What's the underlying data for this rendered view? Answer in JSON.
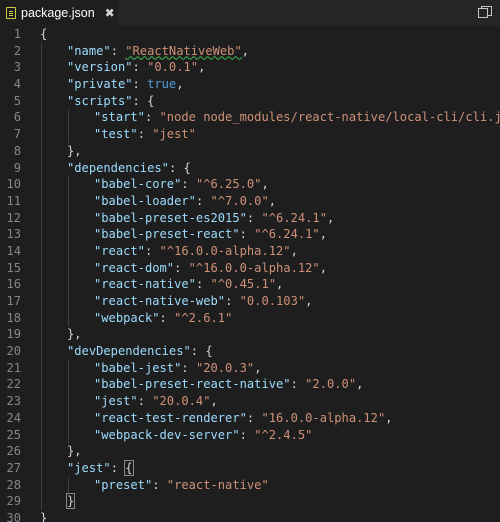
{
  "tab": {
    "title": "package.json",
    "close_glyph": "✖",
    "icon": "json-file-icon"
  },
  "toolbar": {
    "split_icon": "split-editor-icon"
  },
  "editor": {
    "lines": [
      {
        "num": "1",
        "indent": 0,
        "tokens": [
          {
            "t": "p",
            "v": "{"
          }
        ]
      },
      {
        "num": "2",
        "indent": 1,
        "tokens": [
          {
            "t": "k",
            "v": "\"name\""
          },
          {
            "t": "p",
            "v": ": "
          },
          {
            "t": "s",
            "v": "\"ReactNativeWeb\"",
            "sq": true
          },
          {
            "t": "p",
            "v": ","
          }
        ]
      },
      {
        "num": "3",
        "indent": 1,
        "tokens": [
          {
            "t": "k",
            "v": "\"version\""
          },
          {
            "t": "p",
            "v": ": "
          },
          {
            "t": "s",
            "v": "\"0.0.1\""
          },
          {
            "t": "p",
            "v": ","
          }
        ]
      },
      {
        "num": "4",
        "indent": 1,
        "tokens": [
          {
            "t": "k",
            "v": "\"private\""
          },
          {
            "t": "p",
            "v": ": "
          },
          {
            "t": "lit",
            "v": "true"
          },
          {
            "t": "p",
            "v": ","
          }
        ]
      },
      {
        "num": "5",
        "indent": 1,
        "tokens": [
          {
            "t": "k",
            "v": "\"scripts\""
          },
          {
            "t": "p",
            "v": ": {"
          }
        ]
      },
      {
        "num": "6",
        "indent": 2,
        "tokens": [
          {
            "t": "k",
            "v": "\"start\""
          },
          {
            "t": "p",
            "v": ": "
          },
          {
            "t": "s",
            "v": "\"node node_modules/react-native/local-cli/cli.js sta"
          }
        ]
      },
      {
        "num": "7",
        "indent": 2,
        "tokens": [
          {
            "t": "k",
            "v": "\"test\""
          },
          {
            "t": "p",
            "v": ": "
          },
          {
            "t": "s",
            "v": "\"jest\""
          }
        ]
      },
      {
        "num": "8",
        "indent": 1,
        "tokens": [
          {
            "t": "p",
            "v": "},"
          }
        ]
      },
      {
        "num": "9",
        "indent": 1,
        "tokens": [
          {
            "t": "k",
            "v": "\"dependencies\""
          },
          {
            "t": "p",
            "v": ": {"
          }
        ]
      },
      {
        "num": "10",
        "indent": 2,
        "tokens": [
          {
            "t": "k",
            "v": "\"babel-core\""
          },
          {
            "t": "p",
            "v": ": "
          },
          {
            "t": "s",
            "v": "\"^6.25.0\""
          },
          {
            "t": "p",
            "v": ","
          }
        ]
      },
      {
        "num": "11",
        "indent": 2,
        "tokens": [
          {
            "t": "k",
            "v": "\"babel-loader\""
          },
          {
            "t": "p",
            "v": ": "
          },
          {
            "t": "s",
            "v": "\"^7.0.0\""
          },
          {
            "t": "p",
            "v": ","
          }
        ]
      },
      {
        "num": "12",
        "indent": 2,
        "tokens": [
          {
            "t": "k",
            "v": "\"babel-preset-es2015\""
          },
          {
            "t": "p",
            "v": ": "
          },
          {
            "t": "s",
            "v": "\"^6.24.1\""
          },
          {
            "t": "p",
            "v": ","
          }
        ]
      },
      {
        "num": "13",
        "indent": 2,
        "tokens": [
          {
            "t": "k",
            "v": "\"babel-preset-react\""
          },
          {
            "t": "p",
            "v": ": "
          },
          {
            "t": "s",
            "v": "\"^6.24.1\""
          },
          {
            "t": "p",
            "v": ","
          }
        ]
      },
      {
        "num": "14",
        "indent": 2,
        "tokens": [
          {
            "t": "k",
            "v": "\"react\""
          },
          {
            "t": "p",
            "v": ": "
          },
          {
            "t": "s",
            "v": "\"^16.0.0-alpha.12\""
          },
          {
            "t": "p",
            "v": ","
          }
        ]
      },
      {
        "num": "15",
        "indent": 2,
        "tokens": [
          {
            "t": "k",
            "v": "\"react-dom\""
          },
          {
            "t": "p",
            "v": ": "
          },
          {
            "t": "s",
            "v": "\"^16.0.0-alpha.12\""
          },
          {
            "t": "p",
            "v": ","
          }
        ]
      },
      {
        "num": "16",
        "indent": 2,
        "tokens": [
          {
            "t": "k",
            "v": "\"react-native\""
          },
          {
            "t": "p",
            "v": ": "
          },
          {
            "t": "s",
            "v": "\"^0.45.1\""
          },
          {
            "t": "p",
            "v": ","
          }
        ]
      },
      {
        "num": "17",
        "indent": 2,
        "tokens": [
          {
            "t": "k",
            "v": "\"react-native-web\""
          },
          {
            "t": "p",
            "v": ": "
          },
          {
            "t": "s",
            "v": "\"0.0.103\""
          },
          {
            "t": "p",
            "v": ","
          }
        ]
      },
      {
        "num": "18",
        "indent": 2,
        "tokens": [
          {
            "t": "k",
            "v": "\"webpack\""
          },
          {
            "t": "p",
            "v": ": "
          },
          {
            "t": "s",
            "v": "\"^2.6.1\""
          }
        ]
      },
      {
        "num": "19",
        "indent": 1,
        "tokens": [
          {
            "t": "p",
            "v": "},"
          }
        ]
      },
      {
        "num": "20",
        "indent": 1,
        "tokens": [
          {
            "t": "k",
            "v": "\"devDependencies\""
          },
          {
            "t": "p",
            "v": ": {"
          }
        ]
      },
      {
        "num": "21",
        "indent": 2,
        "tokens": [
          {
            "t": "k",
            "v": "\"babel-jest\""
          },
          {
            "t": "p",
            "v": ": "
          },
          {
            "t": "s",
            "v": "\"20.0.3\""
          },
          {
            "t": "p",
            "v": ","
          }
        ]
      },
      {
        "num": "22",
        "indent": 2,
        "tokens": [
          {
            "t": "k",
            "v": "\"babel-preset-react-native\""
          },
          {
            "t": "p",
            "v": ": "
          },
          {
            "t": "s",
            "v": "\"2.0.0\""
          },
          {
            "t": "p",
            "v": ","
          }
        ]
      },
      {
        "num": "23",
        "indent": 2,
        "tokens": [
          {
            "t": "k",
            "v": "\"jest\""
          },
          {
            "t": "p",
            "v": ": "
          },
          {
            "t": "s",
            "v": "\"20.0.4\""
          },
          {
            "t": "p",
            "v": ","
          }
        ]
      },
      {
        "num": "24",
        "indent": 2,
        "tokens": [
          {
            "t": "k",
            "v": "\"react-test-renderer\""
          },
          {
            "t": "p",
            "v": ": "
          },
          {
            "t": "s",
            "v": "\"16.0.0-alpha.12\""
          },
          {
            "t": "p",
            "v": ","
          }
        ]
      },
      {
        "num": "25",
        "indent": 2,
        "tokens": [
          {
            "t": "k",
            "v": "\"webpack-dev-server\""
          },
          {
            "t": "p",
            "v": ": "
          },
          {
            "t": "s",
            "v": "\"^2.4.5\""
          }
        ]
      },
      {
        "num": "26",
        "indent": 1,
        "tokens": [
          {
            "t": "p",
            "v": "},"
          }
        ]
      },
      {
        "num": "27",
        "indent": 1,
        "tokens": [
          {
            "t": "k",
            "v": "\"jest\""
          },
          {
            "t": "p",
            "v": ": "
          },
          {
            "t": "p",
            "v": "{",
            "bm": true
          }
        ]
      },
      {
        "num": "28",
        "indent": 2,
        "tokens": [
          {
            "t": "k",
            "v": "\"preset\""
          },
          {
            "t": "p",
            "v": ": "
          },
          {
            "t": "s",
            "v": "\"react-native\""
          }
        ]
      },
      {
        "num": "29",
        "indent": 1,
        "tokens": [
          {
            "t": "p",
            "v": "}",
            "bm": true
          }
        ]
      },
      {
        "num": "30",
        "indent": 0,
        "tokens": [
          {
            "t": "p",
            "v": "}"
          }
        ]
      }
    ]
  },
  "colors": {
    "background": "#1e1e1e",
    "tabbar": "#252526",
    "key": "#9cdcfe",
    "string": "#ce9178",
    "literal": "#569cd6",
    "punctuation": "#d4d4d4",
    "line_number": "#858585",
    "squiggle": "#3fb950"
  }
}
